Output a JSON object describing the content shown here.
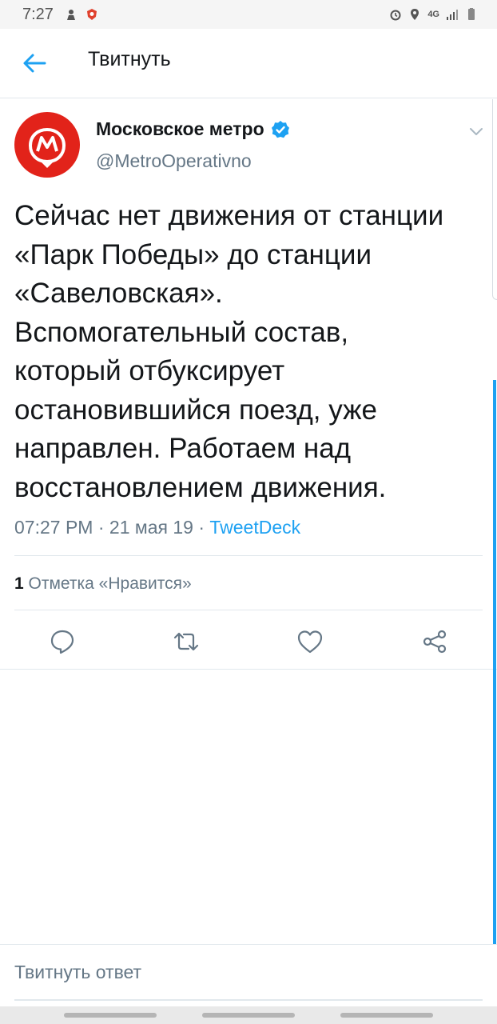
{
  "status_bar": {
    "time": "7:27",
    "network": "4G",
    "icons": [
      "person-icon",
      "shield-icon",
      "alarm-icon",
      "location-icon",
      "data-icon",
      "signal-icon",
      "battery-icon"
    ]
  },
  "header": {
    "title": "Твитнуть",
    "back_icon": "back-arrow-icon"
  },
  "tweet": {
    "author_name": "Московское метро",
    "handle": "@MetroOperativno",
    "verified": true,
    "text": "Сейчас нет движения от станции «Парк Победы» до станции «Савеловская». Вспомогательный состав, который отбуксирует остановившийся поезд, уже направлен. Работаем над восстановлением движения.",
    "time": "07:27 PM",
    "date": "21 мая 19",
    "source": "TweetDeck",
    "separator": "·",
    "likes_count": "1",
    "likes_label": "Отметка «Нравится»"
  },
  "actions": [
    "reply-icon",
    "retweet-icon",
    "like-icon",
    "share-icon"
  ],
  "reply": {
    "placeholder": "Твитнуть ответ"
  },
  "colors": {
    "accent": "#1da1f2",
    "secondary_text": "#657786",
    "metro_red": "#e2231a",
    "divider": "#e1e8ed"
  }
}
